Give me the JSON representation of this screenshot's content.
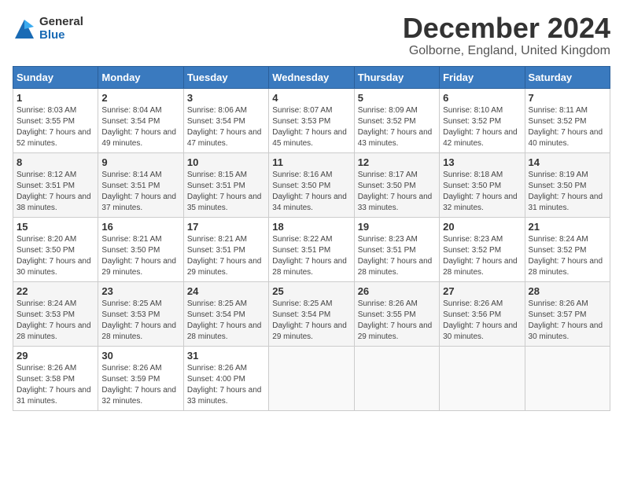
{
  "logo": {
    "general": "General",
    "blue": "Blue"
  },
  "title": "December 2024",
  "subtitle": "Golborne, England, United Kingdom",
  "days_of_week": [
    "Sunday",
    "Monday",
    "Tuesday",
    "Wednesday",
    "Thursday",
    "Friday",
    "Saturday"
  ],
  "weeks": [
    [
      {
        "day": "1",
        "sunrise": "Sunrise: 8:03 AM",
        "sunset": "Sunset: 3:55 PM",
        "daylight": "Daylight: 7 hours and 52 minutes."
      },
      {
        "day": "2",
        "sunrise": "Sunrise: 8:04 AM",
        "sunset": "Sunset: 3:54 PM",
        "daylight": "Daylight: 7 hours and 49 minutes."
      },
      {
        "day": "3",
        "sunrise": "Sunrise: 8:06 AM",
        "sunset": "Sunset: 3:54 PM",
        "daylight": "Daylight: 7 hours and 47 minutes."
      },
      {
        "day": "4",
        "sunrise": "Sunrise: 8:07 AM",
        "sunset": "Sunset: 3:53 PM",
        "daylight": "Daylight: 7 hours and 45 minutes."
      },
      {
        "day": "5",
        "sunrise": "Sunrise: 8:09 AM",
        "sunset": "Sunset: 3:52 PM",
        "daylight": "Daylight: 7 hours and 43 minutes."
      },
      {
        "day": "6",
        "sunrise": "Sunrise: 8:10 AM",
        "sunset": "Sunset: 3:52 PM",
        "daylight": "Daylight: 7 hours and 42 minutes."
      },
      {
        "day": "7",
        "sunrise": "Sunrise: 8:11 AM",
        "sunset": "Sunset: 3:52 PM",
        "daylight": "Daylight: 7 hours and 40 minutes."
      }
    ],
    [
      {
        "day": "8",
        "sunrise": "Sunrise: 8:12 AM",
        "sunset": "Sunset: 3:51 PM",
        "daylight": "Daylight: 7 hours and 38 minutes."
      },
      {
        "day": "9",
        "sunrise": "Sunrise: 8:14 AM",
        "sunset": "Sunset: 3:51 PM",
        "daylight": "Daylight: 7 hours and 37 minutes."
      },
      {
        "day": "10",
        "sunrise": "Sunrise: 8:15 AM",
        "sunset": "Sunset: 3:51 PM",
        "daylight": "Daylight: 7 hours and 35 minutes."
      },
      {
        "day": "11",
        "sunrise": "Sunrise: 8:16 AM",
        "sunset": "Sunset: 3:50 PM",
        "daylight": "Daylight: 7 hours and 34 minutes."
      },
      {
        "day": "12",
        "sunrise": "Sunrise: 8:17 AM",
        "sunset": "Sunset: 3:50 PM",
        "daylight": "Daylight: 7 hours and 33 minutes."
      },
      {
        "day": "13",
        "sunrise": "Sunrise: 8:18 AM",
        "sunset": "Sunset: 3:50 PM",
        "daylight": "Daylight: 7 hours and 32 minutes."
      },
      {
        "day": "14",
        "sunrise": "Sunrise: 8:19 AM",
        "sunset": "Sunset: 3:50 PM",
        "daylight": "Daylight: 7 hours and 31 minutes."
      }
    ],
    [
      {
        "day": "15",
        "sunrise": "Sunrise: 8:20 AM",
        "sunset": "Sunset: 3:50 PM",
        "daylight": "Daylight: 7 hours and 30 minutes."
      },
      {
        "day": "16",
        "sunrise": "Sunrise: 8:21 AM",
        "sunset": "Sunset: 3:50 PM",
        "daylight": "Daylight: 7 hours and 29 minutes."
      },
      {
        "day": "17",
        "sunrise": "Sunrise: 8:21 AM",
        "sunset": "Sunset: 3:51 PM",
        "daylight": "Daylight: 7 hours and 29 minutes."
      },
      {
        "day": "18",
        "sunrise": "Sunrise: 8:22 AM",
        "sunset": "Sunset: 3:51 PM",
        "daylight": "Daylight: 7 hours and 28 minutes."
      },
      {
        "day": "19",
        "sunrise": "Sunrise: 8:23 AM",
        "sunset": "Sunset: 3:51 PM",
        "daylight": "Daylight: 7 hours and 28 minutes."
      },
      {
        "day": "20",
        "sunrise": "Sunrise: 8:23 AM",
        "sunset": "Sunset: 3:52 PM",
        "daylight": "Daylight: 7 hours and 28 minutes."
      },
      {
        "day": "21",
        "sunrise": "Sunrise: 8:24 AM",
        "sunset": "Sunset: 3:52 PM",
        "daylight": "Daylight: 7 hours and 28 minutes."
      }
    ],
    [
      {
        "day": "22",
        "sunrise": "Sunrise: 8:24 AM",
        "sunset": "Sunset: 3:53 PM",
        "daylight": "Daylight: 7 hours and 28 minutes."
      },
      {
        "day": "23",
        "sunrise": "Sunrise: 8:25 AM",
        "sunset": "Sunset: 3:53 PM",
        "daylight": "Daylight: 7 hours and 28 minutes."
      },
      {
        "day": "24",
        "sunrise": "Sunrise: 8:25 AM",
        "sunset": "Sunset: 3:54 PM",
        "daylight": "Daylight: 7 hours and 28 minutes."
      },
      {
        "day": "25",
        "sunrise": "Sunrise: 8:25 AM",
        "sunset": "Sunset: 3:54 PM",
        "daylight": "Daylight: 7 hours and 29 minutes."
      },
      {
        "day": "26",
        "sunrise": "Sunrise: 8:26 AM",
        "sunset": "Sunset: 3:55 PM",
        "daylight": "Daylight: 7 hours and 29 minutes."
      },
      {
        "day": "27",
        "sunrise": "Sunrise: 8:26 AM",
        "sunset": "Sunset: 3:56 PM",
        "daylight": "Daylight: 7 hours and 30 minutes."
      },
      {
        "day": "28",
        "sunrise": "Sunrise: 8:26 AM",
        "sunset": "Sunset: 3:57 PM",
        "daylight": "Daylight: 7 hours and 30 minutes."
      }
    ],
    [
      {
        "day": "29",
        "sunrise": "Sunrise: 8:26 AM",
        "sunset": "Sunset: 3:58 PM",
        "daylight": "Daylight: 7 hours and 31 minutes."
      },
      {
        "day": "30",
        "sunrise": "Sunrise: 8:26 AM",
        "sunset": "Sunset: 3:59 PM",
        "daylight": "Daylight: 7 hours and 32 minutes."
      },
      {
        "day": "31",
        "sunrise": "Sunrise: 8:26 AM",
        "sunset": "Sunset: 4:00 PM",
        "daylight": "Daylight: 7 hours and 33 minutes."
      },
      null,
      null,
      null,
      null
    ]
  ]
}
